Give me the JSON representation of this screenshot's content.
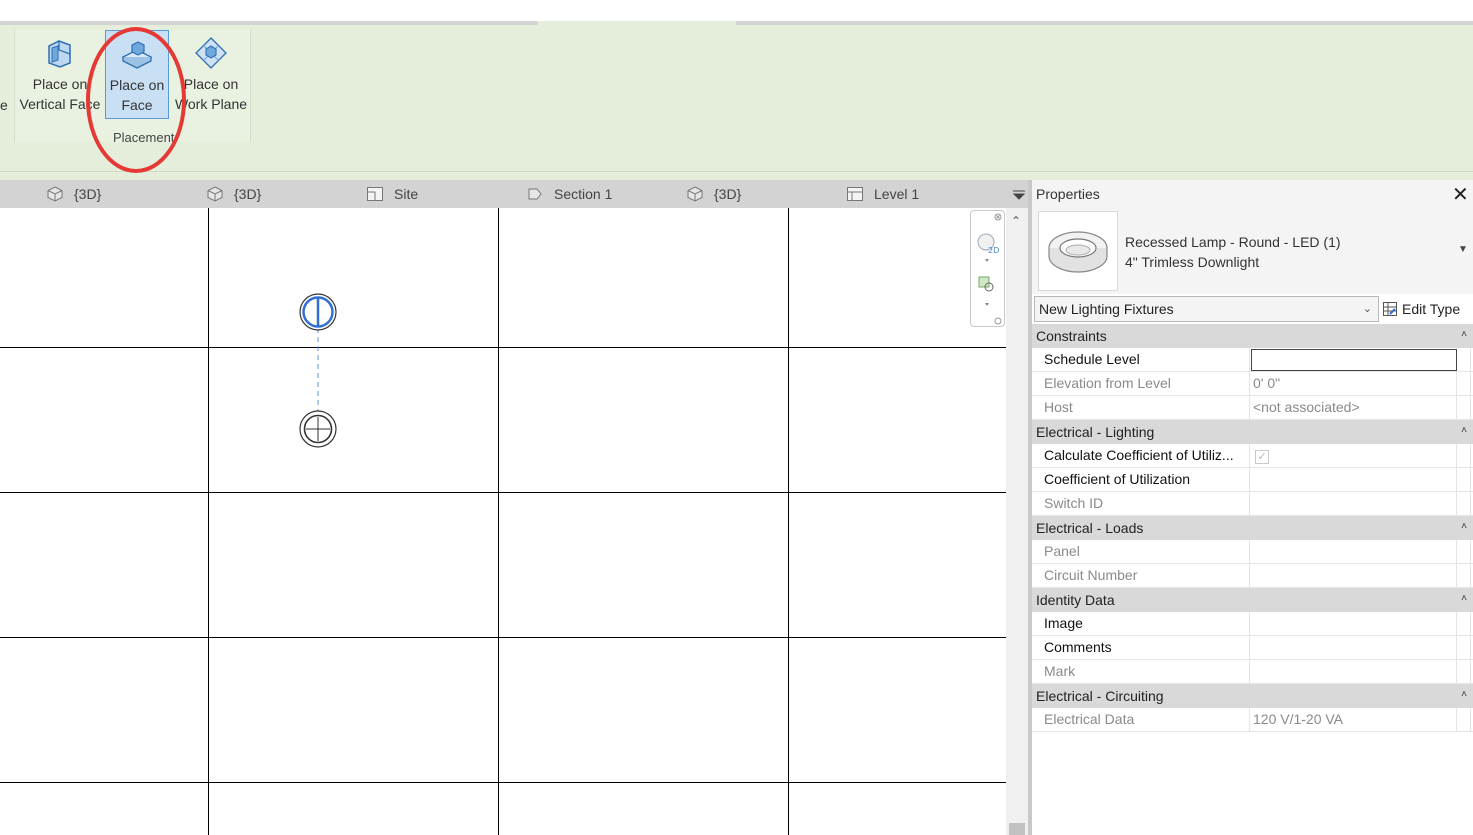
{
  "ribbon": {
    "cut_label": "e",
    "buttons": [
      {
        "line1": "Place on",
        "line2": "Vertical Face",
        "icon": "vertical-face-icon"
      },
      {
        "line1": "Place on",
        "line2": "Face",
        "icon": "face-icon",
        "active": true
      },
      {
        "line1": "Place on",
        "line2": "Work Plane",
        "icon": "work-plane-icon"
      }
    ],
    "panel_title": "Placement"
  },
  "view_tabs": [
    {
      "label": "{3D}",
      "icon": "3d-view-icon"
    },
    {
      "label": "{3D}",
      "icon": "3d-view-icon"
    },
    {
      "label": "Site",
      "icon": "plan-view-icon"
    },
    {
      "label": "Section 1",
      "icon": "section-view-icon"
    },
    {
      "label": "{3D}",
      "icon": "3d-view-icon"
    },
    {
      "label": "Level 1",
      "icon": "plan-view-icon"
    }
  ],
  "properties": {
    "title": "Properties",
    "type_line1": "Recessed Lamp - Round - LED (1)",
    "type_line2": "4\" Trimless Downlight",
    "filter": "New Lighting Fixtures",
    "edit_type": "Edit Type",
    "sections": [
      {
        "name": "Constraints",
        "rows": [
          {
            "name": "Schedule Level",
            "value": "",
            "editing": true,
            "dim": false
          },
          {
            "name": "Elevation from Level",
            "value": "0'  0\"",
            "dim": true
          },
          {
            "name": "Host",
            "value": "<not associated>",
            "dim": true
          }
        ]
      },
      {
        "name": "Electrical - Lighting",
        "rows": [
          {
            "name": "Calculate Coefficient of Utiliz...",
            "value": "",
            "checkbox": true,
            "dim": false
          },
          {
            "name": "Coefficient of Utilization",
            "value": "",
            "dim": false
          },
          {
            "name": "Switch ID",
            "value": "",
            "dim": true
          }
        ]
      },
      {
        "name": "Electrical - Loads",
        "rows": [
          {
            "name": "Panel",
            "value": "",
            "dim": true
          },
          {
            "name": "Circuit Number",
            "value": "",
            "dim": true
          }
        ]
      },
      {
        "name": "Identity Data",
        "rows": [
          {
            "name": "Image",
            "value": "",
            "dim": false
          },
          {
            "name": "Comments",
            "value": "",
            "dim": false
          },
          {
            "name": "Mark",
            "value": "",
            "dim": true
          }
        ]
      },
      {
        "name": "Electrical - Circuiting",
        "rows": [
          {
            "name": "Electrical Data",
            "value": "120 V/1-20 VA",
            "dim": true
          }
        ]
      }
    ]
  },
  "colors": {
    "ribbon_bg": "#e4eedb",
    "active_button": "#c9dff3",
    "highlight_circle": "#e53935",
    "fixture_blue": "#2f6fd6"
  }
}
